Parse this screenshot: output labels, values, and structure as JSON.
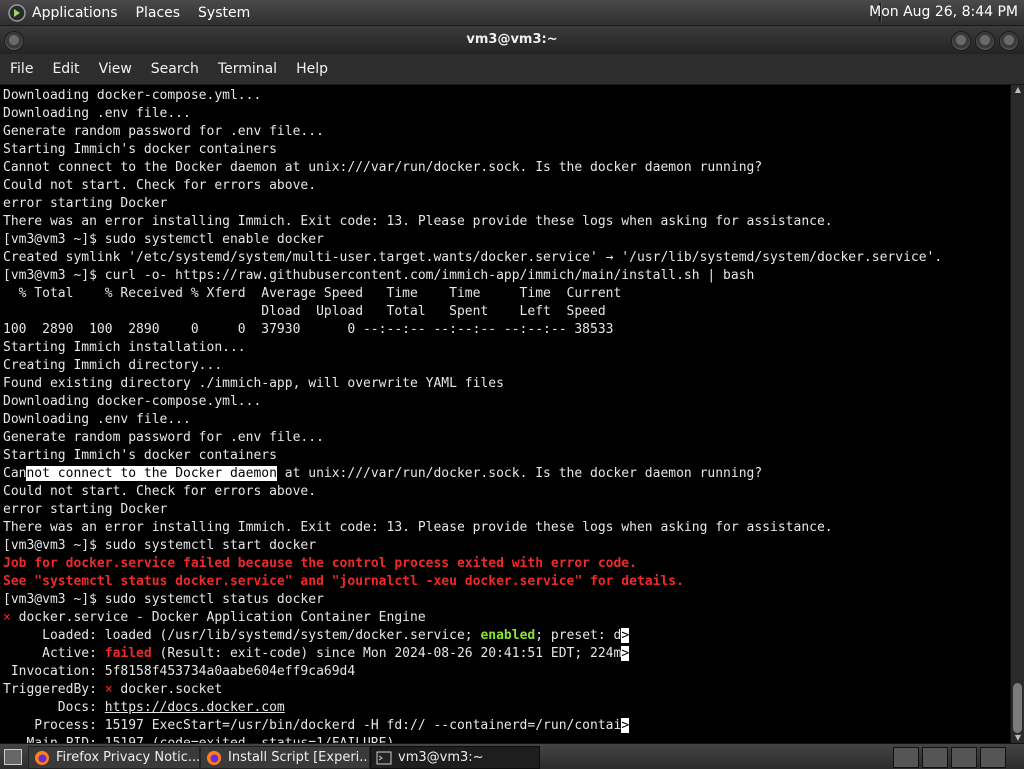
{
  "top_panel": {
    "menus": [
      "Applications",
      "Places",
      "System"
    ],
    "clock": "Mon Aug 26,  8:44 PM"
  },
  "window": {
    "title": "vm3@vm3:~"
  },
  "menubar": [
    "File",
    "Edit",
    "View",
    "Search",
    "Terminal",
    "Help"
  ],
  "terminal": {
    "lines": [
      "Downloading docker-compose.yml...",
      "Downloading .env file...",
      "Generate random password for .env file...",
      "Starting Immich's docker containers",
      "Cannot connect to the Docker daemon at unix:///var/run/docker.sock. Is the docker daemon running?",
      "Could not start. Check for errors above.",
      "error starting Docker",
      "There was an error installing Immich. Exit code: 13. Please provide these logs when asking for assistance.",
      "[vm3@vm3 ~]$ sudo systemctl enable docker",
      "Created symlink '/etc/systemd/system/multi-user.target.wants/docker.service' → '/usr/lib/systemd/system/docker.service'.",
      "[vm3@vm3 ~]$ curl -o- https://raw.githubusercontent.com/immich-app/immich/main/install.sh | bash",
      "  % Total    % Received % Xferd  Average Speed   Time    Time     Time  Current",
      "                                 Dload  Upload   Total   Spent    Left  Speed",
      "100  2890  100  2890    0     0  37930      0 --:--:-- --:--:-- --:--:-- 38533",
      "Starting Immich installation...",
      "Creating Immich directory...",
      "Found existing directory ./immich-app, will overwrite YAML files",
      "Downloading docker-compose.yml...",
      "Downloading .env file...",
      "Generate random password for .env file...",
      "Starting Immich's docker containers"
    ],
    "sel_line": {
      "before": "Can",
      "selected": "not connect to the Docker daemon",
      "after": " at unix:///var/run/docker.sock. Is the docker daemon running?"
    },
    "lines2": [
      "Could not start. Check for errors above.",
      "error starting Docker",
      "There was an error installing Immich. Exit code: 13. Please provide these logs when asking for assistance.",
      "[vm3@vm3 ~]$ sudo systemctl start docker"
    ],
    "error_lines": [
      "Job for docker.service failed because the control process exited with error code.",
      "See \"systemctl status docker.service\" and \"journalctl -xeu docker.service\" for details."
    ],
    "status_cmd": "[vm3@vm3 ~]$ sudo systemctl status docker",
    "status": {
      "bullet": "×",
      "unit": " docker.service - Docker Application Container Engine",
      "loaded_pre": "     Loaded: loaded (/usr/lib/systemd/system/docker.service; ",
      "loaded_enabled": "enabled",
      "loaded_post": "; preset: d",
      "active_pre": "     Active: ",
      "active_failed": "failed",
      "active_post": " (Result: exit-code) since Mon 2024-08-26 20:41:51 EDT; 224m",
      "invocation": " Invocation: 5f8158f453734a0aabe604eff9ca69d4",
      "triggered_pre": "TriggeredBy: ",
      "triggered_post": " docker.socket",
      "docs_pre": "       Docs: ",
      "docs_link": "https://docs.docker.com",
      "process": "    Process: 15197 ExecStart=/usr/bin/dockerd -H fd:// --containerd=/run/contai",
      "mainpid": "   Main PID: 15197 (code=exited, status=1/FAILURE)",
      "trunc_mark": ">"
    }
  },
  "taskbar": {
    "tasks": [
      "Firefox Privacy Notic...",
      "Install Script [Experi...",
      "vm3@vm3:~"
    ]
  }
}
